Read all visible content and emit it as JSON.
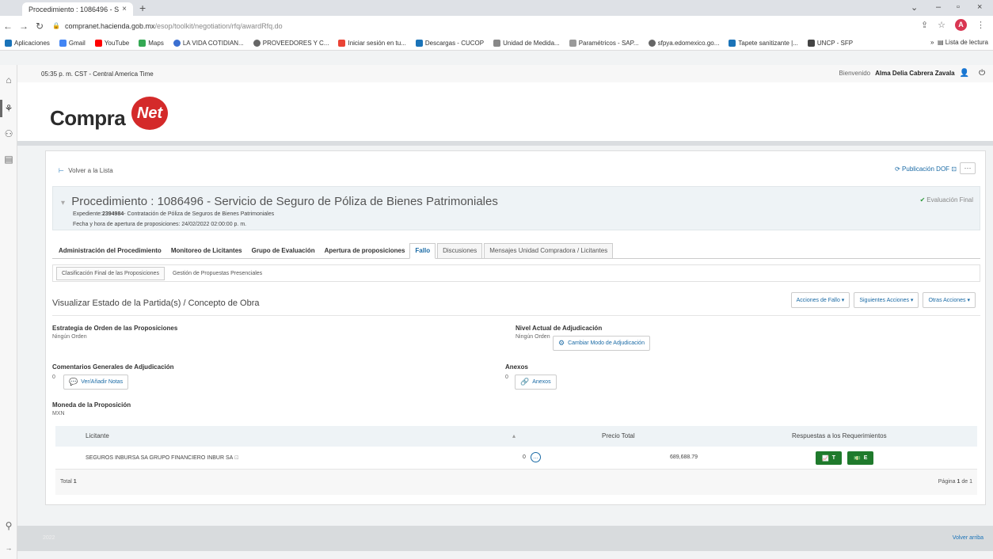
{
  "browser": {
    "tab_title": "Procedimiento : 1086496 - Servi",
    "tab_close": "×",
    "new_tab": "+",
    "url_host": "compranet.hacienda.gob.mx",
    "url_path": "/esop/toolkit/negotiation/rfq/awardRfq.do",
    "avatar_letter": "A",
    "minimize": "–",
    "restore": "▫",
    "close": "×"
  },
  "bookmarks": {
    "apps_label": "Aplicaciones",
    "items": [
      {
        "label": "Gmail",
        "color": "#4285f4"
      },
      {
        "label": "YouTube",
        "color": "#ff0000"
      },
      {
        "label": "Maps",
        "color": "#34a853"
      },
      {
        "label": "LA VIDA COTIDIAN...",
        "color": "#3b6fd1"
      },
      {
        "label": "PROVEEDORES Y C...",
        "color": "#666666"
      },
      {
        "label": "Iniciar sesión en tu...",
        "color": "#ea4335"
      },
      {
        "label": "Descargas - CUCOP",
        "color": "#1a73b8"
      },
      {
        "label": "Unidad de Medida...",
        "color": "#888888"
      },
      {
        "label": "Paramétricos - SAP...",
        "color": "#999999"
      },
      {
        "label": "sfpya.edomexico.go...",
        "color": "#666666"
      },
      {
        "label": "Tapete sanitizante |...",
        "color": "#1a73b8"
      },
      {
        "label": "UNCP - SFP",
        "color": "#444444"
      }
    ],
    "reading_list": "Lista de lectura"
  },
  "app": {
    "time_zone": "05:35 p. m. CST - Central America Time",
    "welcome": "Bienvenido",
    "user_name": "Alma Delia Cabrera Zavala",
    "logo_text": "Compra",
    "logo_badge": "Net"
  },
  "panel": {
    "back_label": "Volver a la Lista",
    "dof_label": "Publicación DOF",
    "more_label": "···",
    "procedure_title": "Procedimiento : 1086496 - Servicio de Seguro de Póliza de Bienes Patrimoniales",
    "expediente_prefix": "Expediente:",
    "expediente_number": "2394984",
    "expediente_desc": "- Contratación de Póliza de Seguros de Bienes Patrimoniales",
    "opening_date": "Fecha y hora de apertura de proposiciones: 24/02/2022 02:00:00 p. m.",
    "status": "Evaluación Final"
  },
  "tabs": [
    {
      "label": "Administración del Procedimiento"
    },
    {
      "label": "Monitoreo de Licitantes"
    },
    {
      "label": "Grupo de Evaluación"
    },
    {
      "label": "Apertura de proposiciones"
    },
    {
      "label": "Fallo"
    },
    {
      "label": "Discusiones"
    },
    {
      "label": "Mensajes Unidad Compradora / Licitantes"
    }
  ],
  "subtabs": [
    {
      "label": "Clasificación Final de las Proposiciones"
    },
    {
      "label": "Gestión de Propuestas Presenciales"
    }
  ],
  "section": {
    "title": "Visualizar Estado de la Partida(s) / Concepto de Obra",
    "actions": [
      "Acciones de Fallo ▾",
      "Siguientes Acciones ▾",
      "Otras Acciones ▾"
    ]
  },
  "fields": {
    "strategy_label": "Estrategia de Orden de las Proposiciones",
    "strategy_value": "Ningún Orden",
    "level_label": "Nivel Actual de Adjudicación",
    "level_value": "Ningún Orden",
    "change_mode_btn": "Cambiar Modo de Adjudicación",
    "comments_label": "Comentarios Generales de Adjudicación",
    "comments_count": "0",
    "notes_btn": "Ver/Añadir Notas",
    "annex_label": "Anexos",
    "annex_count": "0",
    "annex_btn": "Anexos",
    "currency_label": "Moneda de la Proposición",
    "currency_value": "MXN"
  },
  "table": {
    "headers": {
      "bidder": "Licitante",
      "sort": "▴",
      "total": "Precio Total",
      "responses": "Respuestas a los Requerimientos"
    },
    "rows": [
      {
        "bidder": "SEGUROS INBURSA SA GRUPO FINANCIERO INBUR SA",
        "msgs": "0",
        "total": "689,688.79",
        "btn_t": "T",
        "btn_e": "E"
      }
    ],
    "total_label": "Total",
    "total_value": "1",
    "pagination_prefix": "Página",
    "pagination_current": "1",
    "pagination_suffix": "de 1"
  },
  "footer": {
    "year": "2022",
    "back_top": "Volver arriba"
  }
}
